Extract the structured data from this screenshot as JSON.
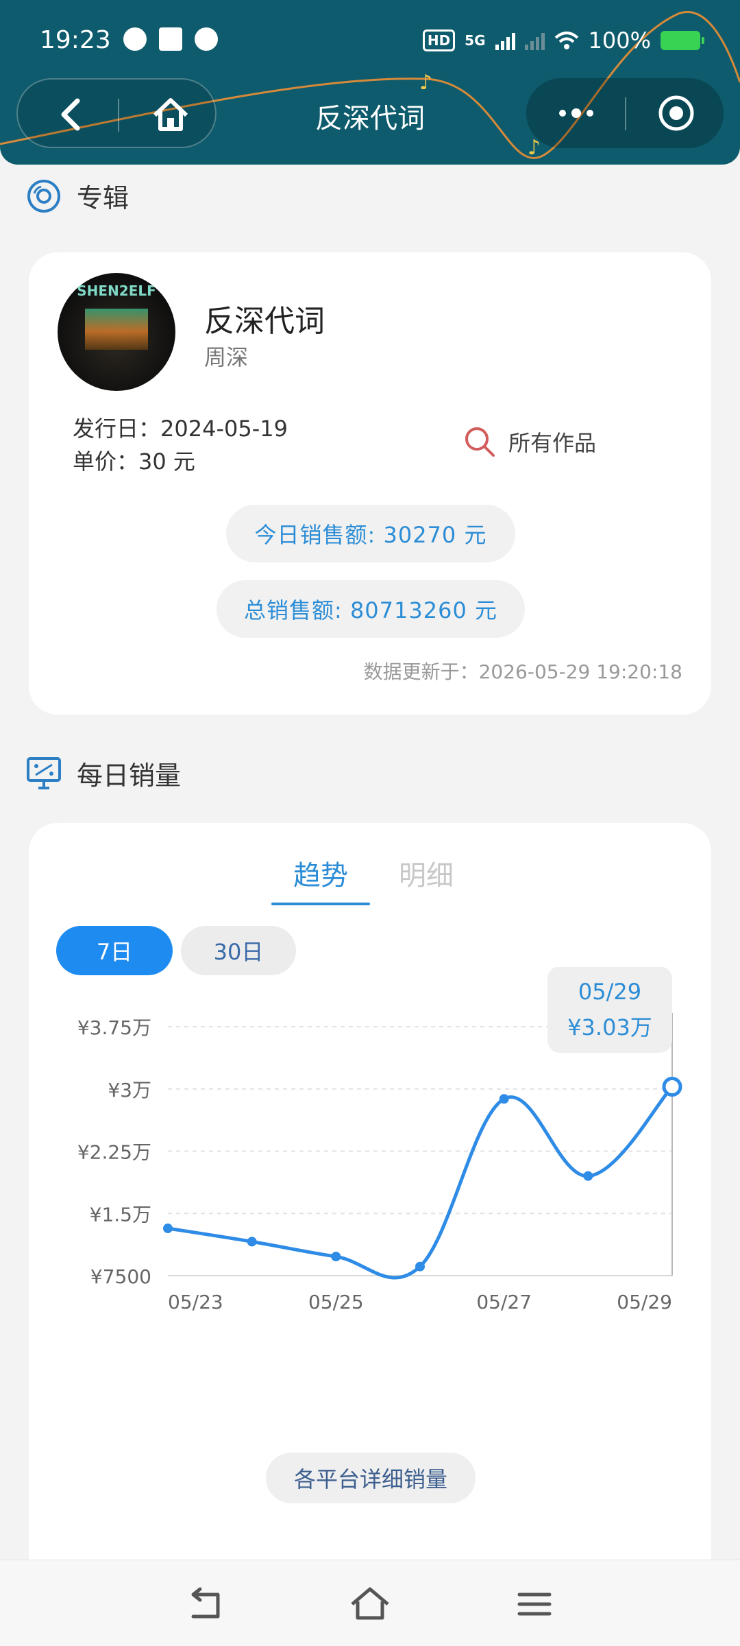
{
  "status_bar": {
    "time": "19:23",
    "hd_label": "HD",
    "network": "5G",
    "battery": "100%"
  },
  "header": {
    "title": "反深代词",
    "colors": {
      "background": "#0d5b6c",
      "wave": "#d68a3a",
      "note": "#f2c94c"
    }
  },
  "album_section": {
    "title": "专辑",
    "album": {
      "name": "反深代词",
      "artist": "周深",
      "cover_text": "SHEN2ELF",
      "release_label": "发行日：",
      "release_date": "2024-05-19",
      "price_label": "单价：",
      "price": "30 元",
      "all_works": "所有作品",
      "today_sales": "今日销售额: 30270 元",
      "total_sales": "总销售额: 80713260 元",
      "updated": "数据更新于：2026-05-29 19:20:18"
    }
  },
  "daily_section": {
    "title": "每日销量",
    "tabs": [
      {
        "label": "趋势",
        "active": true
      },
      {
        "label": "明细",
        "active": false
      }
    ],
    "ranges": [
      {
        "label": "7日",
        "active": true
      },
      {
        "label": "30日",
        "active": false
      }
    ],
    "detail_button": "各平台详细销量"
  },
  "chart_data": {
    "type": "line",
    "x": [
      "05/23",
      "05/24",
      "05/25",
      "05/26",
      "05/27",
      "05/28",
      "05/29"
    ],
    "x_tick_labels": [
      "05/23",
      "05/25",
      "05/27",
      "05/29"
    ],
    "series": [
      {
        "values": [
          13200,
          11600,
          9800,
          8600,
          28800,
          19500,
          30270
        ]
      }
    ],
    "y_ticks": [
      7500,
      15000,
      22500,
      30000,
      37500
    ],
    "y_tick_labels": [
      "¥7500",
      "¥1.5万",
      "¥2.25万",
      "¥3万",
      "¥3.75万"
    ],
    "ylim": [
      7500,
      37500
    ],
    "grid": true,
    "line_color": "#2e8be6",
    "tooltip": {
      "date": "05/29",
      "value": "¥3.03万"
    }
  }
}
